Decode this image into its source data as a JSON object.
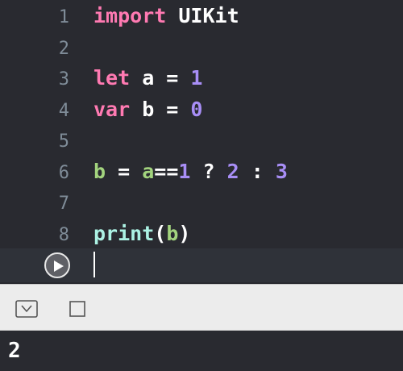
{
  "editor": {
    "lines": [
      {
        "num": "1",
        "tokens": [
          {
            "t": "import",
            "c": "keyword"
          },
          {
            "t": " UIKit",
            "c": "plain"
          }
        ]
      },
      {
        "num": "2",
        "tokens": []
      },
      {
        "num": "3",
        "tokens": [
          {
            "t": "let",
            "c": "keyword"
          },
          {
            "t": " a = ",
            "c": "plain"
          },
          {
            "t": "1",
            "c": "num"
          }
        ]
      },
      {
        "num": "4",
        "tokens": [
          {
            "t": "var",
            "c": "keyword"
          },
          {
            "t": " b = ",
            "c": "plain"
          },
          {
            "t": "0",
            "c": "num"
          }
        ]
      },
      {
        "num": "5",
        "tokens": []
      },
      {
        "num": "6",
        "tokens": [
          {
            "t": "b",
            "c": "ident"
          },
          {
            "t": " = ",
            "c": "plain"
          },
          {
            "t": "a",
            "c": "ident"
          },
          {
            "t": "==",
            "c": "plain"
          },
          {
            "t": "1",
            "c": "num"
          },
          {
            "t": " ? ",
            "c": "plain"
          },
          {
            "t": "2",
            "c": "num"
          },
          {
            "t": " : ",
            "c": "plain"
          },
          {
            "t": "3",
            "c": "num"
          }
        ]
      },
      {
        "num": "7",
        "tokens": []
      },
      {
        "num": "8",
        "tokens": [
          {
            "t": "print",
            "c": "green"
          },
          {
            "t": "(",
            "c": "plain"
          },
          {
            "t": "b",
            "c": "ident"
          },
          {
            "t": ")",
            "c": "plain"
          }
        ]
      }
    ],
    "run_icon": "play-icon"
  },
  "toolbar": {
    "hide_debug_icon": "hide-debug-area-icon",
    "stop_icon": "stop-icon"
  },
  "console": {
    "output": "2"
  },
  "colors": {
    "editor_bg": "#292a30",
    "keyword": "#ff7ab2",
    "number": "#a88ef6",
    "identifier": "#a3d47e",
    "function": "#acf2e4",
    "line_number": "#7f8c98",
    "toolbar_bg": "#ececec"
  }
}
